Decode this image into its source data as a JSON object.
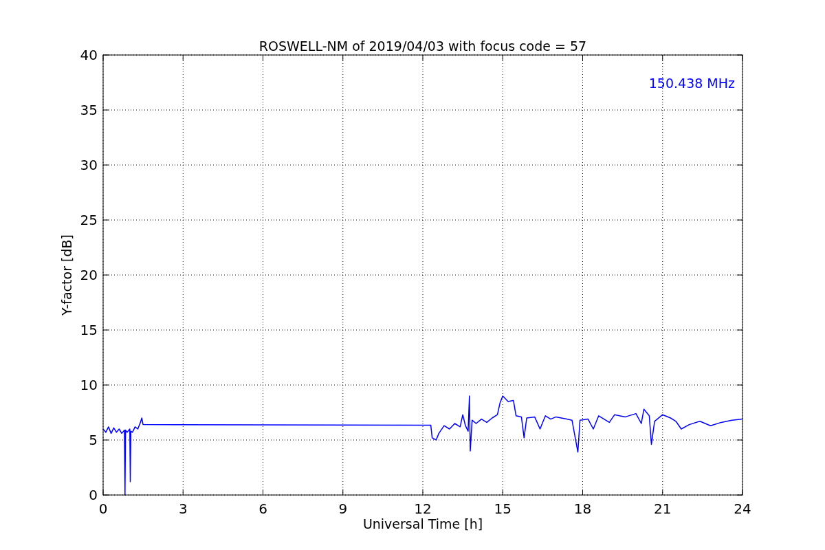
{
  "chart_data": {
    "type": "line",
    "title": "ROSWELL-NM of 2019/04/03 with focus code = 57",
    "xlabel": "Universal Time [h]",
    "ylabel": "Y-factor [dB]",
    "x": [
      0,
      0.1,
      0.2,
      0.3,
      0.4,
      0.5,
      0.6,
      0.7,
      0.8,
      0.82,
      0.84,
      0.9,
      1.0,
      1.02,
      1.04,
      1.1,
      1.2,
      1.3,
      1.4,
      1.45,
      1.5,
      12.3,
      12.35,
      12.5,
      12.6,
      12.8,
      13.0,
      13.2,
      13.4,
      13.5,
      13.6,
      13.7,
      13.75,
      13.78,
      13.85,
      14.0,
      14.2,
      14.4,
      14.6,
      14.8,
      14.9,
      15.0,
      15.2,
      15.4,
      15.5,
      15.7,
      15.8,
      15.9,
      16.2,
      16.4,
      16.6,
      16.8,
      17.0,
      17.4,
      17.6,
      17.82,
      17.9,
      18.2,
      18.4,
      18.6,
      19.0,
      19.2,
      19.6,
      20.0,
      20.2,
      20.3,
      20.5,
      20.58,
      20.7,
      21.0,
      21.3,
      21.5,
      21.7,
      22.0,
      22.4,
      22.8,
      23.2,
      23.6,
      24.0
    ],
    "series": [
      {
        "name": "150.438 MHz",
        "color": "#0000ff",
        "values": [
          6.0,
          5.7,
          6.2,
          5.6,
          6.1,
          5.7,
          6.0,
          5.6,
          5.9,
          0,
          5.9,
          5.7,
          6.0,
          1.2,
          5.8,
          5.7,
          6.2,
          6.0,
          6.6,
          7.0,
          6.4,
          6.35,
          5.2,
          5.0,
          5.6,
          6.3,
          6.0,
          6.5,
          6.2,
          7.3,
          6.3,
          5.8,
          9.0,
          4.0,
          6.8,
          6.5,
          6.9,
          6.6,
          7.0,
          7.3,
          8.4,
          9.0,
          8.5,
          8.6,
          7.2,
          7.1,
          5.2,
          7.0,
          7.1,
          6.0,
          7.2,
          6.9,
          7.1,
          6.9,
          6.8,
          3.9,
          6.8,
          6.9,
          6.0,
          7.2,
          6.6,
          7.3,
          7.1,
          7.4,
          6.5,
          7.8,
          7.2,
          4.6,
          6.7,
          7.3,
          7.0,
          6.7,
          6.0,
          6.4,
          6.7,
          6.3,
          6.6,
          6.8,
          6.9
        ]
      }
    ],
    "xlim": [
      0,
      24
    ],
    "ylim": [
      0,
      40
    ],
    "xticks": [
      0,
      3,
      6,
      9,
      12,
      15,
      18,
      21,
      24
    ],
    "yticks": [
      0,
      5,
      10,
      15,
      20,
      25,
      30,
      35,
      40
    ],
    "grid": true
  }
}
